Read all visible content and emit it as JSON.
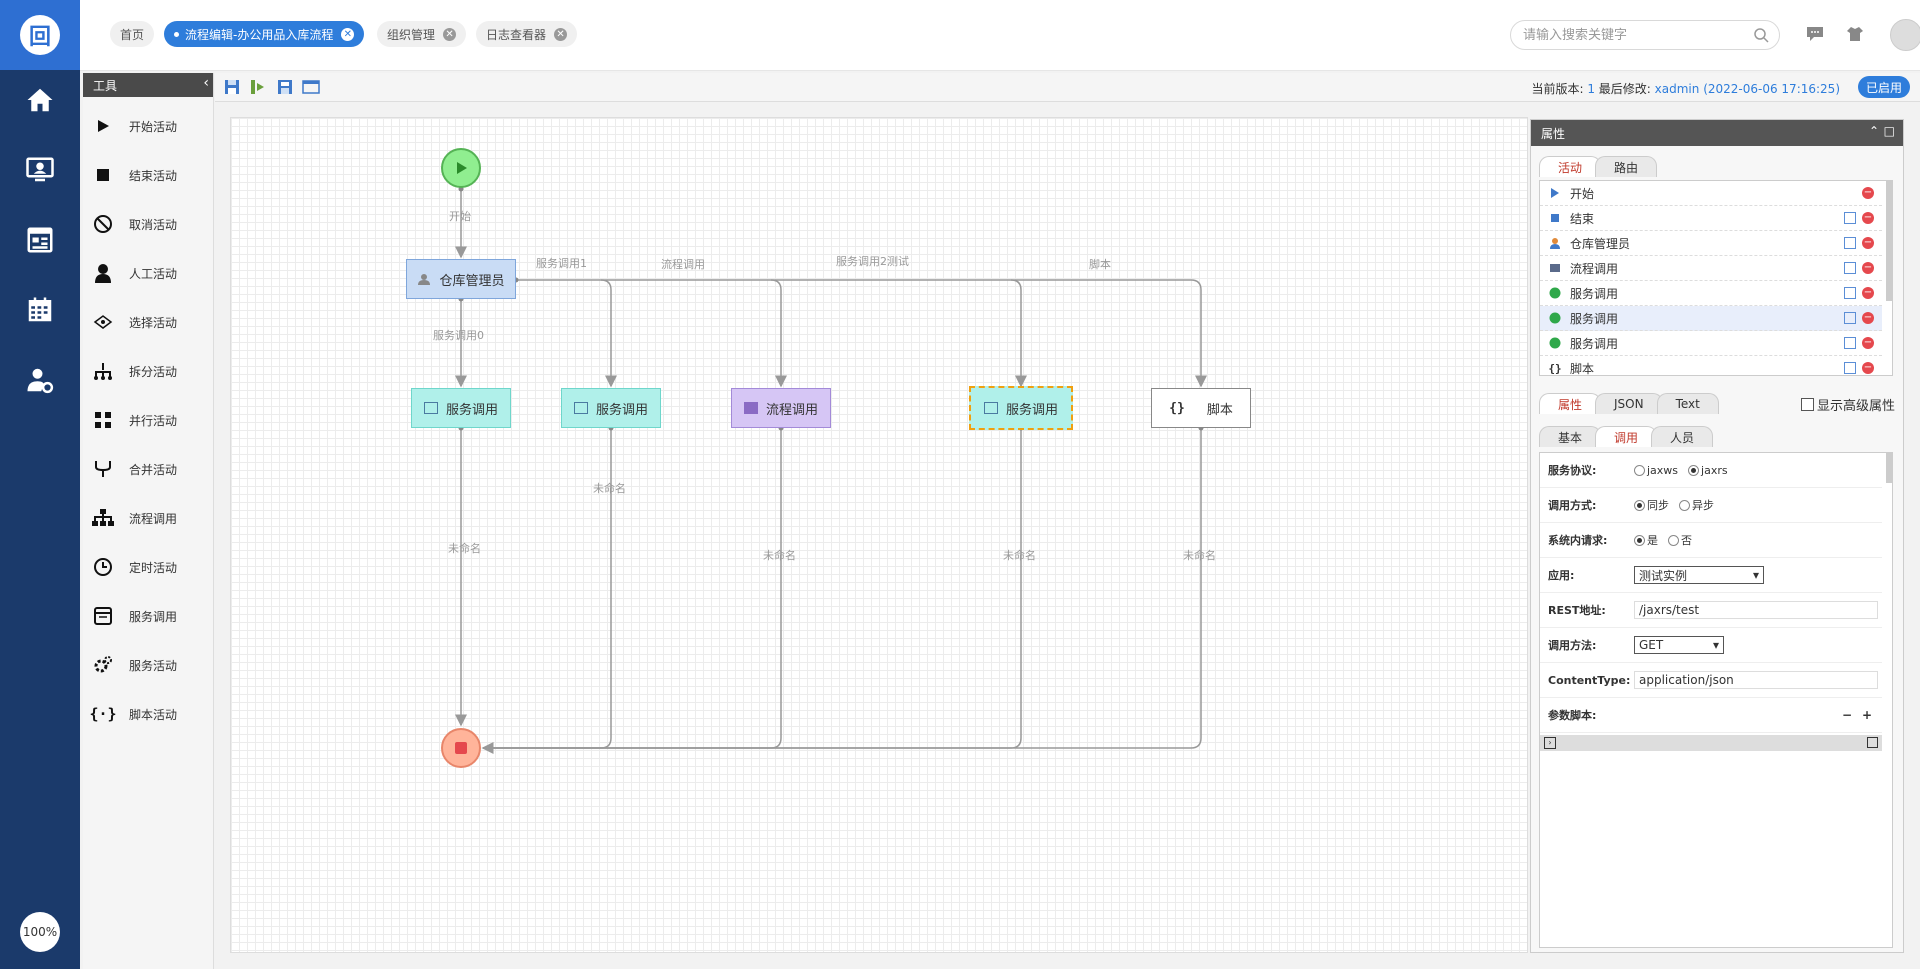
{
  "header": {
    "tabs": [
      {
        "label": "首页",
        "active": false,
        "closable": false
      },
      {
        "label": "流程编辑-办公用品入库流程",
        "active": true,
        "closable": true
      },
      {
        "label": "组织管理",
        "active": false,
        "closable": true
      },
      {
        "label": "日志查看器",
        "active": false,
        "closable": true
      }
    ],
    "search_placeholder": "请输入搜索关键字",
    "username": "xadmin"
  },
  "leftnav": {
    "icons": [
      "home-icon",
      "monitor-user-icon",
      "newspaper-icon",
      "calendar-icon",
      "user-settings-icon"
    ],
    "zoom": "100%"
  },
  "toolbox": {
    "title": "工具",
    "items": [
      {
        "label": "开始活动",
        "icon": "play-icon"
      },
      {
        "label": "结束活动",
        "icon": "stop-icon"
      },
      {
        "label": "取消活动",
        "icon": "ban-icon"
      },
      {
        "label": "人工活动",
        "icon": "person-icon"
      },
      {
        "label": "选择活动",
        "icon": "choice-icon"
      },
      {
        "label": "拆分活动",
        "icon": "split-icon"
      },
      {
        "label": "并行活动",
        "icon": "parallel-icon"
      },
      {
        "label": "合并活动",
        "icon": "merge-icon"
      },
      {
        "label": "流程调用",
        "icon": "sitemap-icon"
      },
      {
        "label": "定时活动",
        "icon": "clock-icon"
      },
      {
        "label": "服务调用",
        "icon": "window-icon"
      },
      {
        "label": "服务活动",
        "icon": "gears-icon"
      },
      {
        "label": "脚本活动",
        "icon": "braces-icon"
      }
    ]
  },
  "editor_toolbar": {
    "version_label": "当前版本:",
    "version": "1",
    "modified_label": "最后修改:",
    "modified_by": "xadmin (2022-06-06 17:16:25)",
    "status": "已启用"
  },
  "diagram": {
    "start_label": "开始",
    "manager": "仓库管理员",
    "nodes": [
      {
        "label": "服务调用",
        "kind": "service"
      },
      {
        "label": "服务调用",
        "kind": "service"
      },
      {
        "label": "流程调用",
        "kind": "process"
      },
      {
        "label": "服务调用",
        "kind": "service-selected"
      },
      {
        "label": "脚本",
        "kind": "script"
      }
    ],
    "edge_labels_top": [
      "服务调用0",
      "服务调用1",
      "流程调用",
      "服务调用2测试",
      "脚本"
    ],
    "edge_labels_bottom": [
      "未命名",
      "未命名",
      "未命名",
      "未命名",
      "未命名"
    ]
  },
  "panel": {
    "title": "属性",
    "top_tabs": [
      "活动",
      "路由"
    ],
    "activities": [
      {
        "label": "开始",
        "icon": "start-triangle-icon",
        "copy": false
      },
      {
        "label": "结束",
        "icon": "end-square-icon",
        "copy": true
      },
      {
        "label": "仓库管理员",
        "icon": "person-icon",
        "copy": true
      },
      {
        "label": "流程调用",
        "icon": "process-icon",
        "copy": true
      },
      {
        "label": "服务调用",
        "icon": "service-globe-icon",
        "copy": true
      },
      {
        "label": "服务调用",
        "icon": "service-globe-icon",
        "copy": true
      },
      {
        "label": "服务调用",
        "icon": "service-globe-icon",
        "copy": true
      },
      {
        "label": "脚本",
        "icon": "braces-icon",
        "copy": true
      }
    ],
    "mid_tabs": [
      "属性",
      "JSON",
      "Text"
    ],
    "advanced_label": "显示高级属性",
    "form_tabs": [
      "基本",
      "调用",
      "人员"
    ],
    "form": {
      "protocol_label": "服务协议:",
      "protocol_options": [
        "jaxws",
        "jaxrs"
      ],
      "protocol_selected": "jaxrs",
      "mode_label": "调用方式:",
      "mode_options": [
        "同步",
        "异步"
      ],
      "mode_selected": "同步",
      "internal_label": "系统内请求:",
      "internal_options": [
        "是",
        "否"
      ],
      "internal_selected": "是",
      "app_label": "应用:",
      "app_value": "测试实例",
      "rest_label": "REST地址:",
      "rest_value": "/jaxrs/test",
      "method_label": "调用方法:",
      "method_value": "GET",
      "ct_label": "ContentType:",
      "ct_value": "application/json",
      "script_label": "参数脚本:",
      "minus": "−",
      "plus": "+"
    }
  }
}
